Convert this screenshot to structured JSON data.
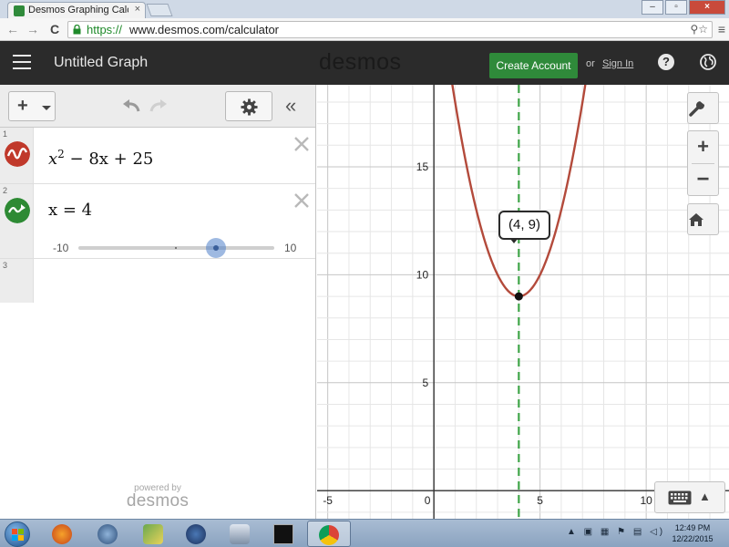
{
  "browser": {
    "tab_title": "Desmos Graphing Calculat",
    "tab_close": "×",
    "url_scheme": "https://",
    "url_rest": "www.desmos.com/calculator",
    "window_buttons": [
      "–",
      "▫",
      "×"
    ],
    "nav_back": "←",
    "nav_forward": "→",
    "nav_reload": "C",
    "omni_icons": "⚲☆",
    "menu": "≡"
  },
  "header": {
    "graph_title": "Untitled Graph",
    "brand": "desmos",
    "create_account": "Create Account",
    "or_text": "or",
    "sign_in": "Sign In",
    "help": "?"
  },
  "panel": {
    "add_button": "+",
    "collapse": "«",
    "expressions": [
      {
        "number": "1",
        "color": "#c0392b",
        "latex_base": "x",
        "latex_exp": "2",
        "latex_rest": " − 8x + 25"
      },
      {
        "number": "2",
        "color": "#2d8a34",
        "latex": "x = 4",
        "slider": {
          "min": "-10",
          "max": "10",
          "value": 4
        }
      },
      {
        "number": "3"
      }
    ],
    "powered_by": "powered by",
    "powered_brand": "desmos"
  },
  "graph": {
    "xlim": [
      -5.5,
      13.9
    ],
    "ylim": [
      -1.3,
      18.8
    ],
    "x_ticks": [
      "-5",
      "0",
      "5",
      "10"
    ],
    "y_ticks": [
      "5",
      "10",
      "15"
    ],
    "curve_color": "#b34a3b",
    "line_color": "#3fa548",
    "tooltip": "(4, 9)",
    "zoom_in": "+",
    "zoom_out": "−",
    "keyboard_caret": "▲"
  },
  "chart_data": {
    "type": "line",
    "series": [
      {
        "name": "x^2 − 8x + 25",
        "function": "x^2 - 8x + 25",
        "color": "#b34a3b"
      },
      {
        "name": "x = 4",
        "vertical_line_x": 4,
        "color": "#3fa548",
        "style": "dashed"
      }
    ],
    "point": {
      "x": 4,
      "y": 9,
      "label": "(4, 9)"
    },
    "xlim": [
      -5.5,
      13.9
    ],
    "ylim": [
      -1.3,
      18.8
    ],
    "x_ticks": [
      -5,
      0,
      5,
      10
    ],
    "y_ticks": [
      5,
      10,
      15
    ],
    "grid": true
  },
  "taskbar": {
    "time": "12:49 PM",
    "date": "12/22/2015",
    "tray": "▲ ▣ ▦ ⚑ ▤ ◁)"
  }
}
